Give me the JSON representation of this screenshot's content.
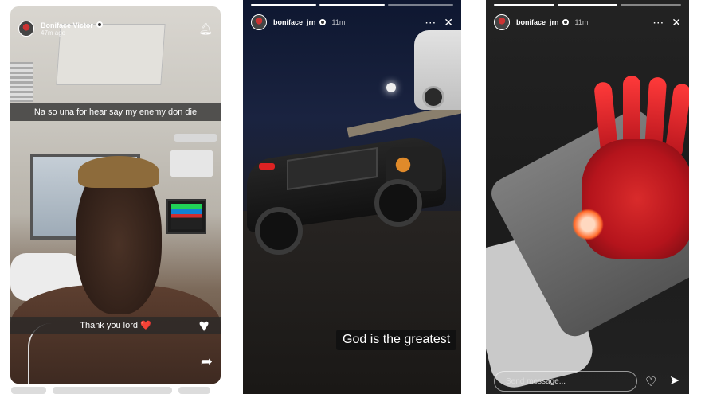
{
  "stories": [
    {
      "username": "Boniface Victor",
      "time": "47m ago",
      "caption_top": "Na so una for hear say my enemy don die",
      "caption_bottom": "Thank you lord",
      "caption_bottom_emoji": "❤️"
    },
    {
      "username": "boniface_jrn",
      "time": "11m",
      "caption": "God is the greatest"
    },
    {
      "username": "boniface_jrn",
      "time": "11m",
      "reply_placeholder": "Send message..."
    }
  ],
  "icons": {
    "bell": "bell-icon",
    "heart": "heart-icon",
    "share": "share-icon",
    "more": "more-icon",
    "close": "close-icon",
    "send": "send-icon"
  }
}
